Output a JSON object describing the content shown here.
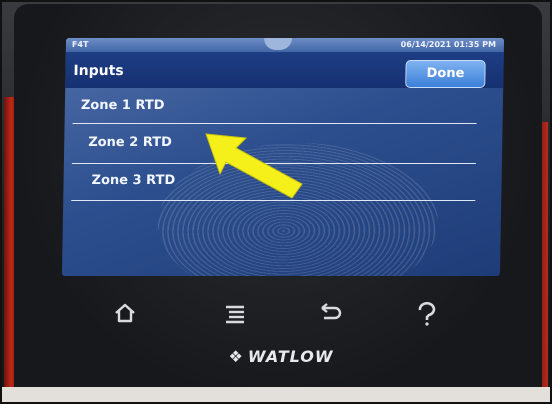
{
  "status": {
    "device_model": "F4T",
    "datetime": "06/14/2021 01:35 PM"
  },
  "header": {
    "title": "Inputs",
    "done_label": "Done"
  },
  "inputs_list": [
    {
      "label": "Zone 1 RTD"
    },
    {
      "label": "Zone 2 RTD"
    },
    {
      "label": "Zone 3 RTD"
    }
  ],
  "hardware": {
    "home_icon": "home-icon",
    "menu_icon": "menu-icon",
    "back_icon": "back-icon",
    "help_icon": "help-icon",
    "brand": "WATLOW"
  },
  "annotation": {
    "arrow_color": "#f5f01a"
  },
  "colors": {
    "screen_blue": "#2d4f8e",
    "title_bar": "#1d3d84",
    "done_button": "#3b7fd8"
  }
}
